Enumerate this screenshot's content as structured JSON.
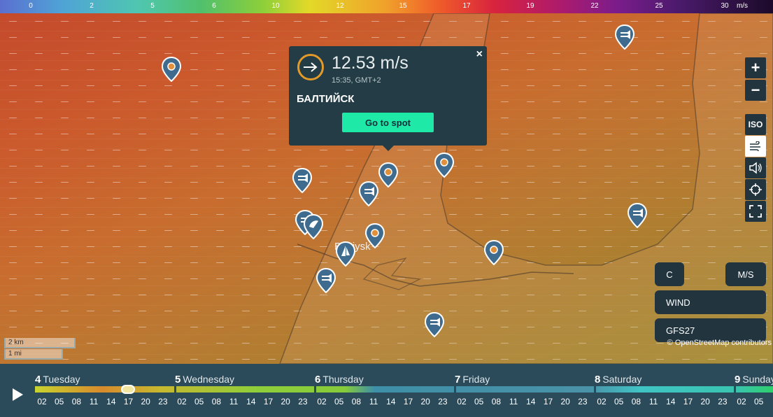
{
  "legend": {
    "values": [
      "0",
      "2",
      "5",
      "6",
      "10",
      "12",
      "15",
      "17",
      "19",
      "22",
      "25",
      "30"
    ],
    "unit": "m/s"
  },
  "popup": {
    "speed": "12.53 m/s",
    "time": "15:35, GMT+2",
    "spot_name": "БАЛТИЙСК",
    "go_button": "Go to spot",
    "close": "×"
  },
  "map": {
    "city_label": "Baltiysk",
    "scale_km": "2 km",
    "scale_mi": "1 mi",
    "attribution": "© OpenStreetMap contributors"
  },
  "controls": {
    "zoom_in": "+",
    "zoom_out": "−",
    "iso": "ISO",
    "units_temp": "C",
    "units_speed": "M/S",
    "layer": "WIND",
    "model": "GFS27"
  },
  "timeline": {
    "days": [
      {
        "num": "4",
        "name": "Tuesday"
      },
      {
        "num": "5",
        "name": "Wednesday"
      },
      {
        "num": "6",
        "name": "Thursday"
      },
      {
        "num": "7",
        "name": "Friday"
      },
      {
        "num": "8",
        "name": "Saturday"
      },
      {
        "num": "9",
        "name": "Sunday"
      }
    ],
    "hours": [
      "02",
      "05",
      "08",
      "11",
      "14",
      "17",
      "20",
      "23"
    ],
    "last_hours": [
      "02",
      "05"
    ],
    "bar_colors": [
      "#d48a2c",
      "#8fce3a",
      "#3e8fa8",
      "#4aa0b8",
      "#47c1c0",
      "#2ed06a"
    ]
  },
  "icons": {
    "play": "play-icon",
    "wind_layer": "wind-icon",
    "sound": "speaker-icon",
    "locate": "crosshair-icon",
    "fullscreen": "fullscreen-icon",
    "direction": "arrow-right-icon",
    "markers": [
      "spot-marker-icon",
      "fish-marker-icon",
      "kite-marker-icon",
      "sail-marker-icon"
    ]
  }
}
